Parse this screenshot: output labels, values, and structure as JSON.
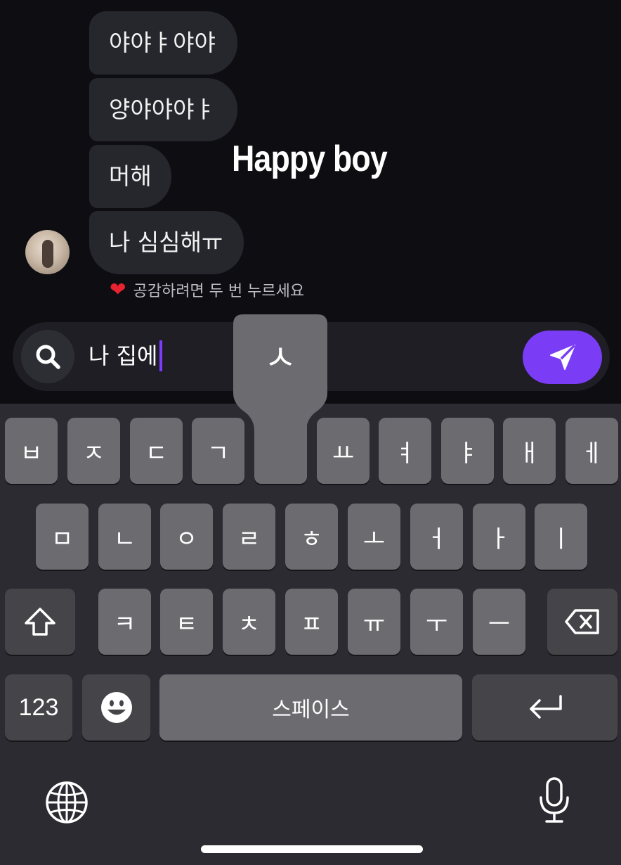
{
  "chat": {
    "overlay_title": "Happy boy",
    "messages": [
      "야야ㅑ야야",
      "양야야야ㅑ",
      "머해",
      "나 심심해ㅠ"
    ],
    "reaction_hint": "공감하려면 두 번 누르세요",
    "reaction_icon": "heart-icon"
  },
  "composer": {
    "typed_text": "나 집에",
    "caret_color": "#7c3cff",
    "send_color": "#7a3cf5",
    "search_icon": "search-icon",
    "send_icon": "send-icon"
  },
  "keyboard": {
    "popup_key": "ㅅ",
    "row1": [
      "ㅂ",
      "ㅈ",
      "ㄷ",
      "ㄱ",
      "ㅅ",
      "ㅛ",
      "ㅕ",
      "ㅑ",
      "ㅐ",
      "ㅔ"
    ],
    "row2": [
      "ㅁ",
      "ㄴ",
      "ㅇ",
      "ㄹ",
      "ㅎ",
      "ㅗ",
      "ㅓ",
      "ㅏ",
      "ㅣ"
    ],
    "row3": [
      "ㅋ",
      "ㅌ",
      "ㅊ",
      "ㅍ",
      "ㅠ",
      "ㅜ",
      "ㅡ"
    ],
    "numbers_label": "123",
    "space_label": "스페이스",
    "shift_icon": "shift-icon",
    "backspace_icon": "backspace-icon",
    "emoji_icon": "emoji-icon",
    "return_icon": "return-icon",
    "globe_icon": "globe-icon",
    "mic_icon": "microphone-icon"
  }
}
